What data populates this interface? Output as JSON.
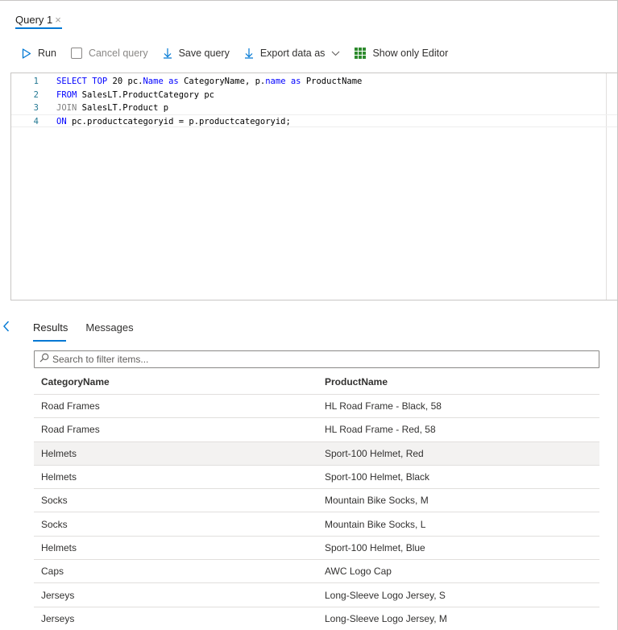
{
  "tab": {
    "label": "Query 1",
    "close": "×"
  },
  "toolbar": {
    "run": "Run",
    "cancel": "Cancel query",
    "save": "Save query",
    "export": "Export data as",
    "show_editor": "Show only Editor"
  },
  "editor": {
    "lines": [
      {
        "num": "1",
        "parts": [
          {
            "t": "SELECT TOP ",
            "k": "kw"
          },
          {
            "t": "20 pc.",
            "k": ""
          },
          {
            "t": "Name",
            "k": "kw"
          },
          {
            "t": " ",
            "k": ""
          },
          {
            "t": "as",
            "k": "kw"
          },
          {
            "t": " CategoryName, p.",
            "k": ""
          },
          {
            "t": "name",
            "k": "kw"
          },
          {
            "t": " ",
            "k": ""
          },
          {
            "t": "as",
            "k": "kw"
          },
          {
            "t": " ProductName",
            "k": ""
          }
        ]
      },
      {
        "num": "2",
        "parts": [
          {
            "t": "FROM",
            "k": "kw"
          },
          {
            "t": " SalesLT.ProductCategory pc",
            "k": ""
          }
        ]
      },
      {
        "num": "3",
        "parts": [
          {
            "t": "JOIN",
            "k": "kwgray"
          },
          {
            "t": " SalesLT.Product p",
            "k": ""
          }
        ]
      },
      {
        "num": "4",
        "parts": [
          {
            "t": "ON",
            "k": "kw"
          },
          {
            "t": " pc.productcategoryid = p.productcategoryid;",
            "k": ""
          }
        ]
      }
    ]
  },
  "results": {
    "tabs": [
      "Results",
      "Messages"
    ],
    "filter_placeholder": "Search to filter items...",
    "columns": [
      "CategoryName",
      "ProductName"
    ],
    "rows": [
      [
        "Road Frames",
        "HL Road Frame - Black, 58"
      ],
      [
        "Road Frames",
        "HL Road Frame - Red, 58"
      ],
      [
        "Helmets",
        "Sport-100 Helmet, Red"
      ],
      [
        "Helmets",
        "Sport-100 Helmet, Black"
      ],
      [
        "Socks",
        "Mountain Bike Socks, M"
      ],
      [
        "Socks",
        "Mountain Bike Socks, L"
      ],
      [
        "Helmets",
        "Sport-100 Helmet, Blue"
      ],
      [
        "Caps",
        "AWC Logo Cap"
      ],
      [
        "Jerseys",
        "Long-Sleeve Logo Jersey, S"
      ],
      [
        "Jerseys",
        "Long-Sleeve Logo Jersey, M"
      ]
    ],
    "selected_row": 2
  },
  "colors": {
    "accent": "#0078d4",
    "export_icon": "#2e8b2e"
  }
}
